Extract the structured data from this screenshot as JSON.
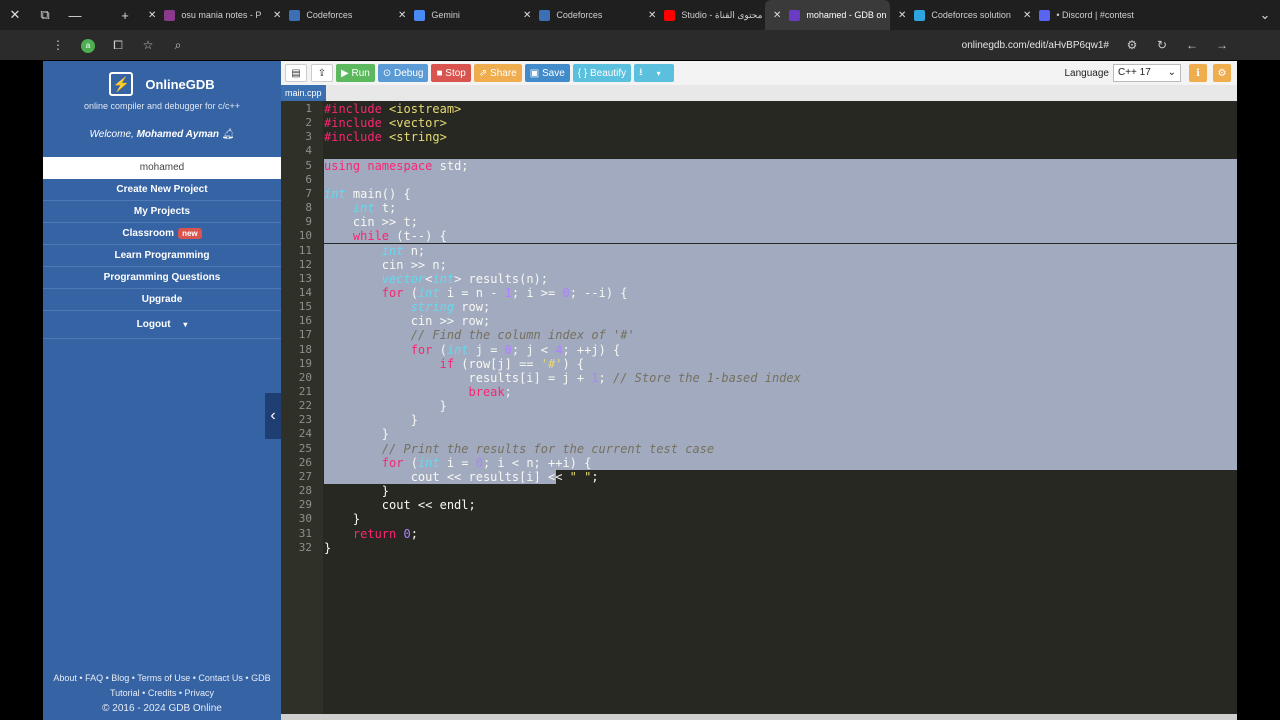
{
  "browser": {
    "tabs": [
      {
        "label": "osu mania notes - P",
        "color": "#8b3a8b"
      },
      {
        "label": "Codeforces",
        "color": "#3b6fb6"
      },
      {
        "label": "Gemini",
        "color": "#4a8af4"
      },
      {
        "label": "Codeforces",
        "color": "#3b6fb6"
      },
      {
        "label": "Studio - محتوى القناة",
        "color": "#ff0000"
      },
      {
        "label": "mohamed - GDB on",
        "color": "#6a3cc4",
        "active": true
      },
      {
        "label": "Codeforces solution",
        "color": "#2ca5e0"
      },
      {
        "label": "• Discord | #contest",
        "color": "#5865f2"
      }
    ],
    "url": "onlinegdb.com/edit/aHvBP6qw1#"
  },
  "sidebar": {
    "brand": "OnlineGDB",
    "tagline": "online compiler and debugger for c/c++",
    "welcome_prefix": "Welcome, ",
    "welcome_name": "Mohamed Ayman",
    "username": "mohamed",
    "items": [
      "Create New Project",
      "My Projects",
      "Classroom",
      "Learn Programming",
      "Programming Questions",
      "Upgrade"
    ],
    "classroom_badge": "new",
    "logout": "Logout",
    "footer_line1": "About • FAQ • Blog • Terms of Use • Contact Us • GDB",
    "footer_line2": "Tutorial • Credits • Privacy",
    "footer_line3": "© 2016 - 2024 GDB Online"
  },
  "toolbar": {
    "run": "Run",
    "debug": "Debug",
    "stop": "Stop",
    "share": "Share",
    "save": "Save",
    "beautify": "{ } Beautify",
    "language_label": "Language",
    "language_value": "C++ 17",
    "colors": {
      "run": "#5cb85c",
      "debug": "#5b9bd5",
      "stop": "#d9534f",
      "share": "#f0ad4e",
      "save": "#428bca",
      "beautify": "#5bc0de"
    }
  },
  "editor": {
    "file": "main.cpp",
    "lines": [
      "#include <iostream>",
      "#include <vector>",
      "#include <string>",
      "",
      "using namespace std;",
      "",
      "int main() {",
      "    int t;",
      "    cin >> t;",
      "    while (t--) {",
      "        int n;",
      "        cin >> n;",
      "        vector<int> results(n);",
      "        for (int i = n - 1; i >= 0; --i) {",
      "            string row;",
      "            cin >> row;",
      "            // Find the column index of '#'",
      "            for (int j = 0; j < 4; ++j) {",
      "                if (row[j] == '#') {",
      "                    results[i] = j + 1; // Store the 1-based index",
      "                    break;",
      "                }",
      "            }",
      "        }",
      "        // Print the results for the current test case",
      "        for (int i = 0; i < n; ++i) {",
      "            cout << results[i] << \" \";",
      "        }",
      "        cout << endl;",
      "    }",
      "    return 0;",
      "}"
    ],
    "selected_from": 5,
    "selected_to": 27
  }
}
